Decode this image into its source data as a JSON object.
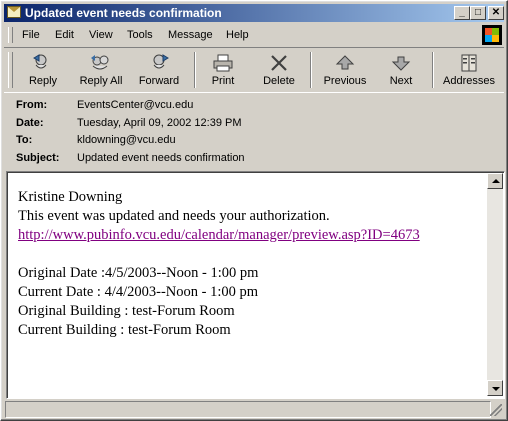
{
  "window": {
    "title": "Updated event needs confirmation",
    "controls": {
      "minimize": "_",
      "maximize": "□",
      "close": "✕"
    }
  },
  "menu": {
    "items": [
      "File",
      "Edit",
      "View",
      "Tools",
      "Message",
      "Help"
    ]
  },
  "toolbar": {
    "buttons": [
      {
        "label": "Reply",
        "icon": "reply-icon"
      },
      {
        "label": "Reply All",
        "icon": "reply-all-icon"
      },
      {
        "label": "Forward",
        "icon": "forward-icon"
      },
      {
        "label": "Print",
        "icon": "print-icon"
      },
      {
        "label": "Delete",
        "icon": "delete-icon"
      },
      {
        "label": "Previous",
        "icon": "previous-icon"
      },
      {
        "label": "Next",
        "icon": "next-icon"
      },
      {
        "label": "Addresses",
        "icon": "addresses-icon"
      }
    ]
  },
  "header": {
    "from_label": "From:",
    "from": "EventsCenter@vcu.edu",
    "date_label": "Date:",
    "date": "Tuesday, April 09, 2002 12:39 PM",
    "to_label": "To:",
    "to": "kldowning@vcu.edu",
    "subject_label": "Subject:",
    "subject": "Updated event needs confirmation"
  },
  "body": {
    "greeting": "Kristine Downing",
    "message": "This event was updated and needs your authorization.",
    "link": "http://www.pubinfo.vcu.edu/calendar/manager/preview.asp?ID=4673",
    "original_date": "Original Date :4/5/2003--Noon - 1:00 pm",
    "current_date": "Current Date : 4/4/2003--Noon - 1:00 pm",
    "original_building": "Original Building : test-Forum Room",
    "current_building": "Current Building : test-Forum Room"
  },
  "colors": {
    "titlebar_start": "#0a246a",
    "titlebar_end": "#a6caf0",
    "link": "#800080",
    "face": "#d4d0c8"
  }
}
